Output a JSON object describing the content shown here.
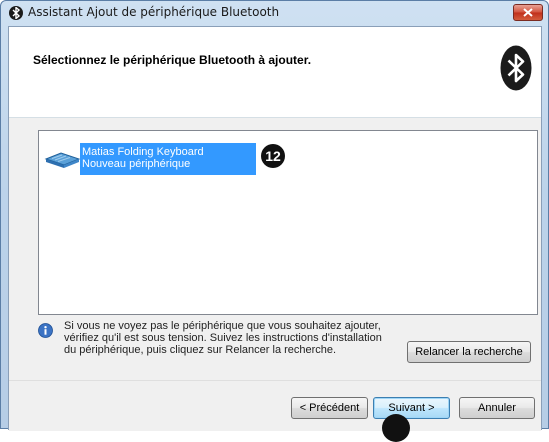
{
  "window": {
    "title": "Assistant Ajout de périphérique Bluetooth",
    "close_icon": "close-icon"
  },
  "header": {
    "title": "Sélectionnez le périphérique Bluetooth à ajouter.",
    "logo_icon": "bluetooth-logo-icon"
  },
  "device_list": {
    "items": [
      {
        "name": "Matias Folding Keyboard",
        "status": "Nouveau périphérique",
        "icon": "keyboard-icon",
        "selected": true
      }
    ]
  },
  "annotation": {
    "badge": "12"
  },
  "info": {
    "icon": "info-icon",
    "lines": [
      "Si vous ne voyez pas le périphérique que vous souhaitez ajouter,",
      "vérifiez qu'il est sous tension. Suivez les instructions d'installation",
      "du périphérique, puis cliquez sur Relancer la recherche."
    ],
    "rescan_label": "Relancer la recherche"
  },
  "footer": {
    "prev_label": "< Précédent",
    "next_label": "Suivant >",
    "cancel_label": "Annuler"
  },
  "colors": {
    "selection": "#3399ff",
    "title_bar": "#bcd3ea",
    "close_button": "#c7432f"
  }
}
